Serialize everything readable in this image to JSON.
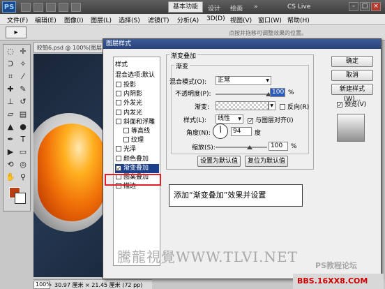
{
  "titlebar": {
    "logo": "PS",
    "workspace": "基本功能",
    "tabs": [
      "设计",
      "绘画"
    ],
    "cslive": "CS Live",
    "win_min": "–",
    "win_max": "□",
    "win_close": "×"
  },
  "menubar": [
    "文件(F)",
    "编辑(E)",
    "图像(I)",
    "图层(L)",
    "选择(S)",
    "滤镜(T)",
    "分析(A)",
    "3D(D)",
    "视图(V)",
    "窗口(W)",
    "帮助(H)"
  ],
  "options": {
    "tool": "▸",
    "hint": "点按并拖移可调整效果的位置。"
  },
  "document": {
    "tab": "皎铂6.psd @ 100%(图层",
    "zoom": "100%",
    "size": "30.97 厘米 × 21.45 厘米 (72 pp)"
  },
  "dialog": {
    "title": "图层样式",
    "styles_header": "样式",
    "blend_header": "混合选项:默认",
    "style_items": [
      {
        "label": "投影",
        "checked": false,
        "indent": false
      },
      {
        "label": "内阴影",
        "checked": false,
        "indent": false
      },
      {
        "label": "外发光",
        "checked": false,
        "indent": false
      },
      {
        "label": "内发光",
        "checked": false,
        "indent": false
      },
      {
        "label": "斜面和浮雕",
        "checked": false,
        "indent": false
      },
      {
        "label": "等高线",
        "checked": false,
        "indent": true
      },
      {
        "label": "纹理",
        "checked": false,
        "indent": true
      },
      {
        "label": "光泽",
        "checked": false,
        "indent": false
      },
      {
        "label": "颜色叠加",
        "checked": false,
        "indent": false
      },
      {
        "label": "渐变叠加",
        "checked": true,
        "indent": false,
        "selected": true
      },
      {
        "label": "图案叠加",
        "checked": false,
        "indent": false
      },
      {
        "label": "描边",
        "checked": false,
        "indent": false
      }
    ],
    "group_title": "渐变叠加",
    "sub_title": "渐变",
    "blend_mode_label": "混合模式(O):",
    "blend_mode_value": "正常",
    "opacity_label": "不透明度(P):",
    "opacity_value": "100",
    "opacity_unit": "%",
    "opacity_level": 100,
    "gradient_label": "渐变:",
    "reverse_label": "反向(R)",
    "reverse_checked": false,
    "style_label": "样式(L):",
    "style_value": "线性",
    "align_label": "与图层对齐(I)",
    "align_checked": true,
    "angle_label": "角度(N):",
    "angle_value": "94",
    "angle_unit": "度",
    "scale_label": "缩放(S):",
    "scale_value": "100",
    "scale_unit": "%",
    "scale_level": 100,
    "set_default": "设置为默认值",
    "reset_default": "复位为默认值",
    "ok": "确定",
    "cancel": "取消",
    "new_style": "新建样式(W)...",
    "preview_label": "预览(V)",
    "preview_checked": true
  },
  "callout": "添加“渐变叠加”效果并设置",
  "watermark": "騰龍視覺WWW.TLVI.NET",
  "watermark_sub": "PS教程论坛",
  "watermark_logo": "BBS.16XX8.COM",
  "colors": {
    "foreground": "#b83d10",
    "background": "#ffffff",
    "selection": "#1c3f8c",
    "highlight": "#e21f26"
  }
}
